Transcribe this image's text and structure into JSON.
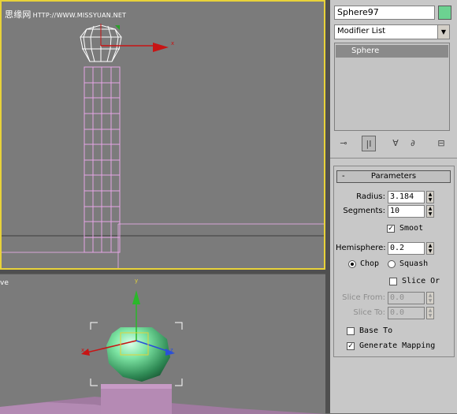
{
  "watermark": {
    "site": "思缘网",
    "url": "HTTP://WWW.MISSYUAN.NET"
  },
  "viewports": {
    "perspective_label": "ve"
  },
  "axes": {
    "x": "x",
    "y": "y",
    "z": "z"
  },
  "object": {
    "name": "Sphere97",
    "color": "#6cd291"
  },
  "modifier_list": {
    "label": "Modifier List"
  },
  "stack": {
    "items": [
      "Sphere"
    ]
  },
  "parameters": {
    "title": "Parameters",
    "collapse": "-",
    "radius_label": "Radius:",
    "radius": "3.184",
    "segments_label": "Segments:",
    "segments": "10",
    "smooth_label": "Smoot",
    "smooth": true,
    "hemisphere_label": "Hemisphere:",
    "hemisphere": "0.2",
    "chop_label": "Chop",
    "squash_label": "Squash",
    "slice_on_label": "Slice Or",
    "slice_from_label": "Slice From:",
    "slice_from": "0.0",
    "slice_to_label": "Slice To:",
    "slice_to": "0.0",
    "base_to_label": "Base To",
    "generate_mapping_label": "Generate Mapping",
    "generate_mapping": true
  }
}
